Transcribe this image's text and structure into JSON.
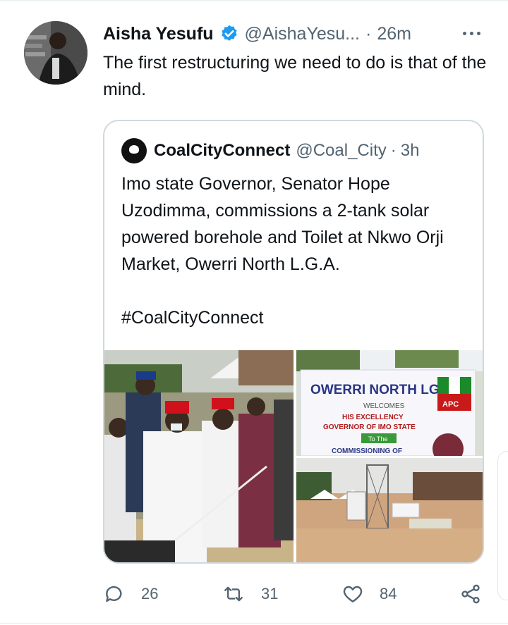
{
  "tweet": {
    "author_name": "Aisha Yesufu",
    "handle": "@AishaYesu...",
    "separator": "·",
    "time": "26m",
    "text": "The first restructuring we need to do is that of the mind.",
    "verified": true
  },
  "quoted": {
    "author_name": "CoalCityConnect",
    "handle": "@Coal_City",
    "separator": "·",
    "time": "3h",
    "text": "Imo state Governor, Senator Hope Uzodimma, commissions a 2-tank solar powered borehole and Toilet at Nkwo Orji Market, Owerri North L.G.A.",
    "hashtag": "#CoalCityConnect",
    "photos": {
      "banner_title": "OWERRI NORTH LGA",
      "banner_welcomes": "WELCOMES",
      "banner_line1": "HIS EXCELLENCY",
      "banner_line2": "GOVERNOR OF IMO STATE",
      "banner_to_the": "To The",
      "banner_commissioning": "COMMISSIONING OF",
      "banner_party": "APC"
    }
  },
  "actions": {
    "replies": "26",
    "retweets": "31",
    "likes": "84"
  },
  "colors": {
    "verified": "#1d9bf0",
    "secondary_text": "#536471",
    "border": "#cfd9de"
  }
}
